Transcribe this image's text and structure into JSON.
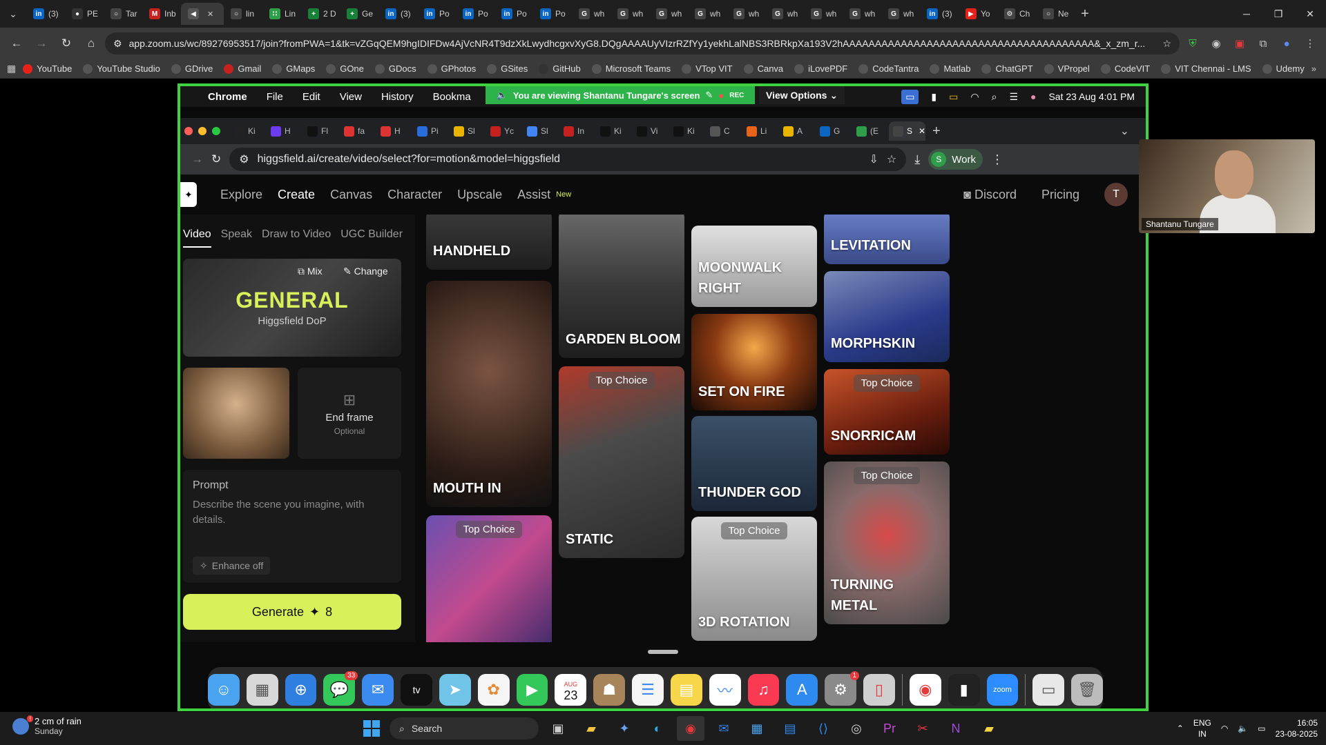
{
  "outer_tabs": [
    {
      "label": "(3)",
      "color": "#0a66c2",
      "glyph": "in"
    },
    {
      "label": "PE",
      "color": "#333",
      "glyph": "●"
    },
    {
      "label": "Tar",
      "color": "#444",
      "glyph": "○"
    },
    {
      "label": "Inb",
      "color": "#c5221f",
      "glyph": "M"
    },
    {
      "label": "",
      "color": "#555",
      "glyph": "◀",
      "active": true
    },
    {
      "label": "lin",
      "color": "#444",
      "glyph": "○"
    },
    {
      "label": "Lin",
      "color": "#2f9e4a",
      "glyph": "∷"
    },
    {
      "label": "2 D",
      "color": "#188038",
      "glyph": "+"
    },
    {
      "label": "Ge",
      "color": "#188038",
      "glyph": "+"
    },
    {
      "label": "(3)",
      "color": "#0a66c2",
      "glyph": "in"
    },
    {
      "label": "Po",
      "color": "#0a66c2",
      "glyph": "in"
    },
    {
      "label": "Po",
      "color": "#0a66c2",
      "glyph": "in"
    },
    {
      "label": "Po",
      "color": "#0a66c2",
      "glyph": "in"
    },
    {
      "label": "Po",
      "color": "#0a66c2",
      "glyph": "in"
    },
    {
      "label": "wh",
      "color": "#444",
      "glyph": "G"
    },
    {
      "label": "wh",
      "color": "#444",
      "glyph": "G"
    },
    {
      "label": "wh",
      "color": "#444",
      "glyph": "G"
    },
    {
      "label": "wh",
      "color": "#444",
      "glyph": "G"
    },
    {
      "label": "wh",
      "color": "#444",
      "glyph": "G"
    },
    {
      "label": "wh",
      "color": "#444",
      "glyph": "G"
    },
    {
      "label": "wh",
      "color": "#444",
      "glyph": "G"
    },
    {
      "label": "wh",
      "color": "#444",
      "glyph": "G"
    },
    {
      "label": "wh",
      "color": "#444",
      "glyph": "G"
    },
    {
      "label": "(3)",
      "color": "#0a66c2",
      "glyph": "in"
    },
    {
      "label": "Yo",
      "color": "#e62117",
      "glyph": "▶"
    },
    {
      "label": "Ch",
      "color": "#444",
      "glyph": "⚙"
    },
    {
      "label": "Ne",
      "color": "#444",
      "glyph": "○"
    }
  ],
  "outer_url": "app.zoom.us/wc/89276953517/join?fromPWA=1&tk=vZGqQEM9hgIDIFDw4AjVcNR4T9dzXkLwydhcgxvXyG8.DQgAAAAUyVIzrRZfYy1yekhLalNBS3RBRkpXa193V2hAAAAAAAAAAAAAAAAAAAAAAAAAAAAAAAAAAAAAAA&_x_zm_r...",
  "bookmarks": [
    {
      "label": "YouTube",
      "color": "#e62117"
    },
    {
      "label": "YouTube Studio",
      "color": "#555"
    },
    {
      "label": "GDrive",
      "color": "#555"
    },
    {
      "label": "Gmail",
      "color": "#c5221f"
    },
    {
      "label": "GMaps",
      "color": "#555"
    },
    {
      "label": "GOne",
      "color": "#555"
    },
    {
      "label": "GDocs",
      "color": "#555"
    },
    {
      "label": "GPhotos",
      "color": "#555"
    },
    {
      "label": "GSites",
      "color": "#555"
    },
    {
      "label": "GitHub",
      "color": "#333"
    },
    {
      "label": "Microsoft Teams",
      "color": "#555"
    },
    {
      "label": "VTop VIT",
      "color": "#555"
    },
    {
      "label": "Canva",
      "color": "#555"
    },
    {
      "label": "iLovePDF",
      "color": "#555"
    },
    {
      "label": "CodeTantra",
      "color": "#555"
    },
    {
      "label": "Matlab",
      "color": "#555"
    },
    {
      "label": "ChatGPT",
      "color": "#555"
    },
    {
      "label": "VPropel",
      "color": "#555"
    },
    {
      "label": "CodeVIT",
      "color": "#555"
    },
    {
      "label": "VIT Chennai - LMS",
      "color": "#555"
    },
    {
      "label": "Udemy",
      "color": "#555"
    }
  ],
  "mac_menu": {
    "app": "Chrome",
    "items": [
      "File",
      "Edit",
      "View",
      "History",
      "Bookma"
    ],
    "banner": "You are viewing Shantanu Tungare's screen",
    "rec": "REC",
    "view_options": "View Options",
    "datetime": "Sat 23 Aug  4:01 PM"
  },
  "inner_tabs": [
    {
      "label": "Ki",
      "color": "#222"
    },
    {
      "label": "H",
      "color": "#6b3cf0"
    },
    {
      "label": "Fl",
      "color": "#111"
    },
    {
      "label": "fa",
      "color": "#d33"
    },
    {
      "label": "H",
      "color": "#d33"
    },
    {
      "label": "Pi",
      "color": "#2a6cdb"
    },
    {
      "label": "Sl",
      "color": "#e8b400"
    },
    {
      "label": "Yc",
      "color": "#c5221f"
    },
    {
      "label": "Sl",
      "color": "#4285f4"
    },
    {
      "label": "In",
      "color": "#c5221f"
    },
    {
      "label": "Ki",
      "color": "#111"
    },
    {
      "label": "Vi",
      "color": "#111"
    },
    {
      "label": "Ki",
      "color": "#111"
    },
    {
      "label": "C",
      "color": "#555"
    },
    {
      "label": "Li",
      "color": "#e8641b"
    },
    {
      "label": "A",
      "color": "#e8b400"
    },
    {
      "label": "G",
      "color": "#0a66c2"
    },
    {
      "label": "(E",
      "color": "#2f9e4a"
    },
    {
      "label": "S",
      "color": "#444",
      "active": true
    }
  ],
  "inner_url": "higgsfield.ai/create/video/select?for=motion&model=higgsfield",
  "work_label": "Work",
  "work_initial": "S",
  "site": {
    "nav": [
      "Explore",
      "Create",
      "Canvas",
      "Character",
      "Upscale",
      "Assist"
    ],
    "nav_active": "Create",
    "new_badge": "New",
    "discord": "Discord",
    "pricing": "Pricing",
    "user_initial": "T"
  },
  "left_panel": {
    "tabs": [
      "Video",
      "Speak",
      "Draw to Video",
      "UGC Builder"
    ],
    "active_tab": "Video",
    "model_title": "GENERAL",
    "model_sub": "Higgsfield DoP",
    "mix": "Mix",
    "change": "Change",
    "end_frame_title": "End frame",
    "end_frame_sub": "Optional",
    "prompt_label": "Prompt",
    "prompt_placeholder": "Describe the scene you imagine, with details.",
    "enhance": "Enhance off",
    "generate": "Generate",
    "generate_cost": "8"
  },
  "gallery": {
    "top_choice": "Top Choice",
    "cards": {
      "handheld": "HANDHELD",
      "mouth_in": "MOUTH IN",
      "garden_bloom": "GARDEN BLOOM",
      "static": "STATIC",
      "moonwalk": "MOONWALK RIGHT",
      "set_on_fire": "SET ON FIRE",
      "thunder_god": "THUNDER GOD",
      "rotation": "3D ROTATION",
      "levitation": "LEVITATION",
      "morphskin": "MORPHSKIN",
      "snorricam": "SNORRICAM",
      "turning_metal": "TURNING METAL"
    }
  },
  "dock": {
    "messages_badge": "33",
    "settings_badge": "1",
    "calendar_month": "AUG",
    "calendar_day": "23"
  },
  "webcam_name": "Shantanu Tungare",
  "taskbar": {
    "weather_main": "2 cm of rain",
    "weather_sub": "Sunday",
    "search": "Search",
    "lang_1": "ENG",
    "lang_2": "IN",
    "time": "16:05",
    "date": "23-08-2025"
  }
}
